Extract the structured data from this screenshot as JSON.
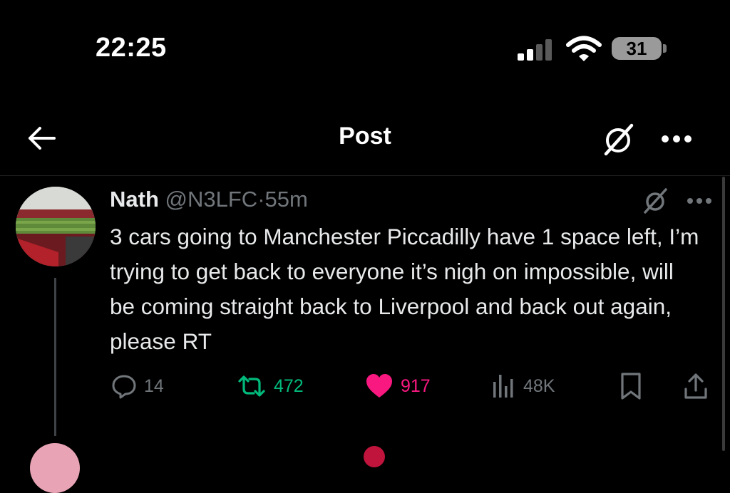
{
  "status_bar": {
    "time": "22:25",
    "battery_level": "31",
    "signal_icon": "cellular-signal-icon",
    "wifi_icon": "wifi-icon"
  },
  "header": {
    "title": "Post",
    "back_icon": "back-arrow-icon",
    "grok_icon": "grok-icon",
    "more_icon": "more-options-icon"
  },
  "post": {
    "author_name": "Nath",
    "author_handle": "@N3LFC",
    "separator": "·",
    "time_ago": "55m",
    "text": "3 cars going to Manchester Piccadilly have 1 space left, I’m trying to get back to everyone it’s nigh on impossible, will be coming straight back to Liverpool and back out again, please RT",
    "avatar_icon": "stadium-avatar"
  },
  "actions": {
    "replies": "14",
    "reposts": "472",
    "likes": "917",
    "views": "48K"
  },
  "colors": {
    "background": "#000000",
    "text": "#e7e9ea",
    "muted": "#71767b",
    "repost": "#00ba7c",
    "like": "#f91880"
  }
}
